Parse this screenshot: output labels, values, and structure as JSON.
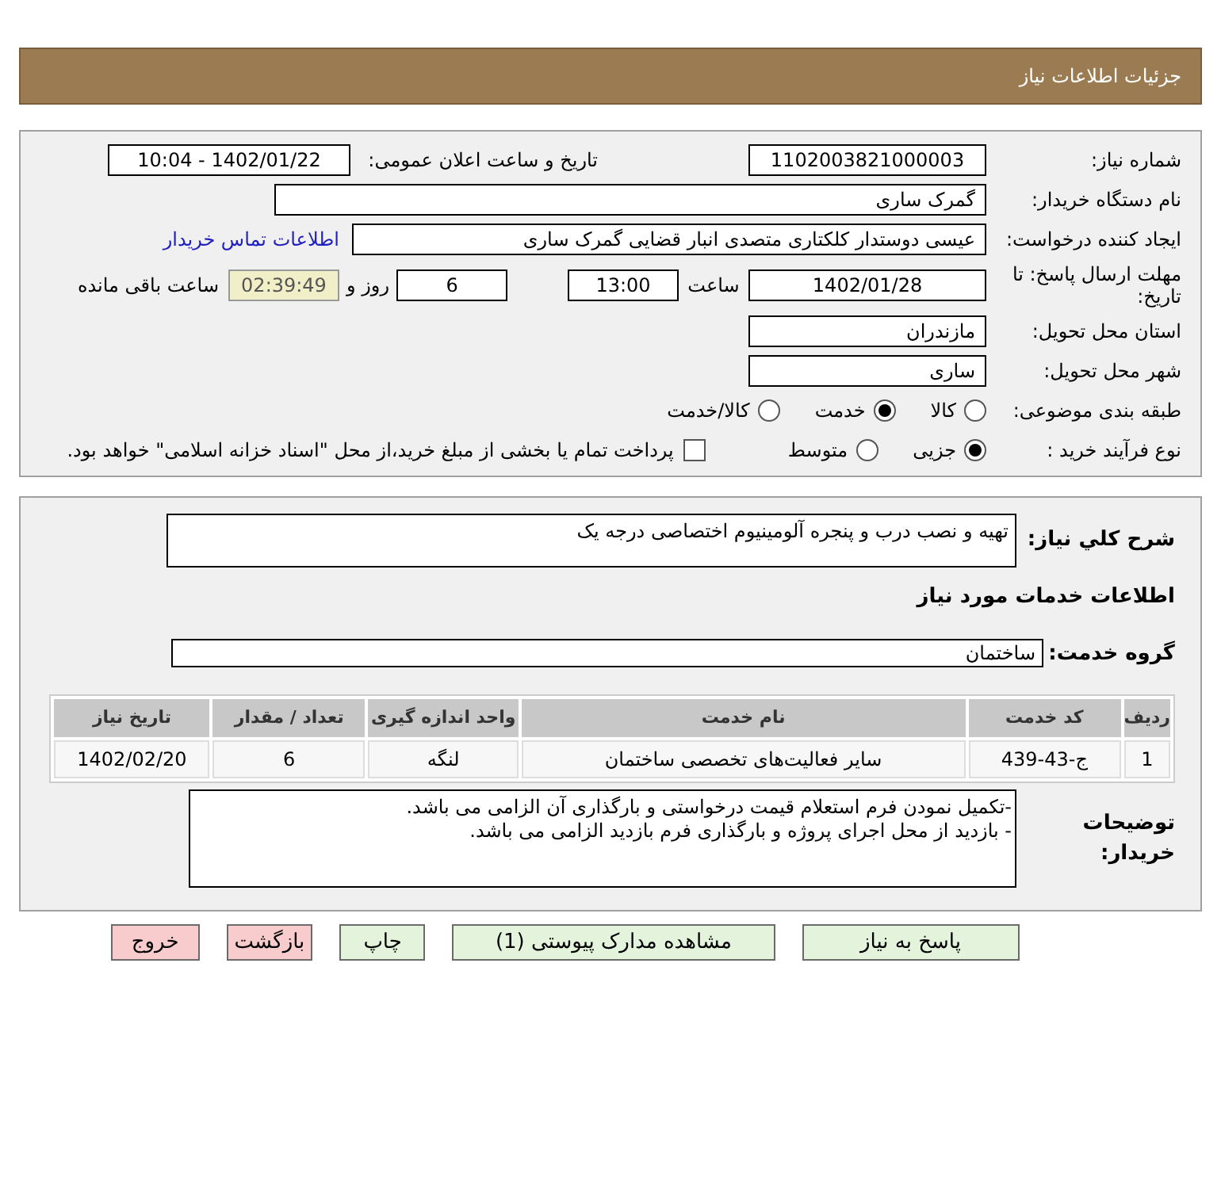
{
  "header": {
    "title": "جزئیات اطلاعات نیاز"
  },
  "details": {
    "need_number": {
      "label": "شماره نیاز:",
      "value": "1102003821000003"
    },
    "announce": {
      "label": "تاریخ و ساعت اعلان عمومی:",
      "value": "1402/01/22 - 10:04"
    },
    "buyer_org": {
      "label": "نام دستگاه خریدار:",
      "value": "گمرک ساری"
    },
    "requester": {
      "label": "ایجاد کننده درخواست:",
      "value": "عیسی دوستدار کلکتاری متصدی انبار قضایی گمرک ساری",
      "link": "اطلاعات تماس خریدار"
    },
    "deadline": {
      "label": "مهلت ارسال پاسخ: تا تاریخ:",
      "date": "1402/01/28",
      "time_label": "ساعت",
      "time": "13:00",
      "days": "6",
      "days_label": "روز و",
      "remaining": "02:39:49",
      "remaining_label": "ساعت باقی مانده"
    },
    "province": {
      "label": "استان محل تحویل:",
      "value": "مازندران"
    },
    "city": {
      "label": "شهر محل تحویل:",
      "value": "ساری"
    },
    "category": {
      "label": "طبقه بندی موضوعی:",
      "options": [
        {
          "label": "کالا",
          "selected": false
        },
        {
          "label": "خدمت",
          "selected": true
        },
        {
          "label": "کالا/خدمت",
          "selected": false
        }
      ]
    },
    "process": {
      "label": "نوع فرآیند خرید :",
      "options": [
        {
          "label": "جزیی",
          "selected": true
        },
        {
          "label": "متوسط",
          "selected": false
        }
      ],
      "payment": {
        "checked": false,
        "text": "پرداخت تمام یا بخشی از مبلغ خرید،از محل \"اسناد خزانه اسلامی\" خواهد بود."
      }
    }
  },
  "services": {
    "summary": {
      "label": "شرح کلي نياز:",
      "value": "تهیه و نصب درب و پنجره آلومینیوم اختصاصی درجه یک"
    },
    "heading": "اطلاعات خدمات مورد نیاز",
    "group": {
      "label": "گروه خدمت:",
      "value": "ساختمان"
    },
    "table": {
      "columns": [
        "ردیف",
        "کد خدمت",
        "نام خدمت",
        "واحد اندازه گیری",
        "تعداد / مقدار",
        "تاریخ نیاز"
      ],
      "rows": [
        [
          "1",
          "ج-43-439",
          "سایر فعالیت‌های تخصصی ساختمان",
          "لنگه",
          "6",
          "1402/02/20"
        ]
      ]
    },
    "notes": {
      "label": "توضیحات خریدار:",
      "lines": [
        "-تکمیل نمودن فرم استعلام قیمت درخواستی و بارگذاری آن الزامی می باشد.",
        "- بازدید از محل اجرای پروژه و بارگذاری فرم بازدید الزامی می باشد."
      ]
    }
  },
  "buttons": [
    {
      "label": "پاسخ به نیاز",
      "kind": "green"
    },
    {
      "label": "مشاهده مدارک پیوستی (1)",
      "kind": "green"
    },
    {
      "label": "چاپ",
      "kind": "green"
    },
    {
      "label": "بازگشت",
      "kind": "red"
    },
    {
      "label": "خروج",
      "kind": "red"
    }
  ]
}
